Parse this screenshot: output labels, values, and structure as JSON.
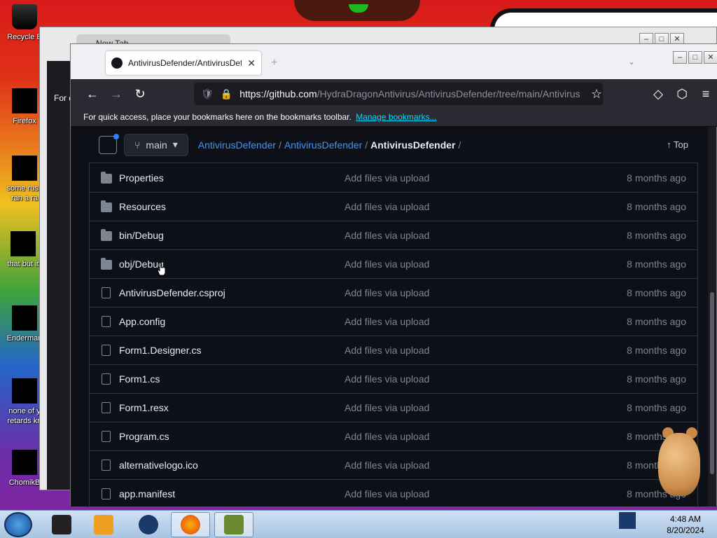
{
  "desktop": {
    "icons": [
      {
        "label": "Recycle B"
      },
      {
        "label": "Firefox"
      },
      {
        "label": "some russ ran a ra"
      },
      {
        "label": "that but it"
      },
      {
        "label": "Enderman"
      },
      {
        "label": "none of y retards kn"
      },
      {
        "label": "ChomikB"
      }
    ]
  },
  "back_window": {
    "tab_label": "New Tab",
    "bookmark_text": "For q"
  },
  "browser": {
    "tab_title": "AntivirusDefender/AntivirusDefender",
    "url_host": "https://github.com",
    "url_path": "/HydraDragonAntivirus/AntivirusDefender/tree/main/Antivirus",
    "bookmarks_text": "For quick access, place your bookmarks here on the bookmarks toolbar.",
    "bookmarks_link": "Manage bookmarks..."
  },
  "repo": {
    "branch": "main",
    "crumb_owner": "AntivirusDefender",
    "crumb_repo": "AntivirusDefender",
    "crumb_current": "AntivirusDefender",
    "top_label": "Top",
    "files": [
      {
        "name": "Properties",
        "type": "folder",
        "message": "Add files via upload",
        "age": "8 months ago"
      },
      {
        "name": "Resources",
        "type": "folder",
        "message": "Add files via upload",
        "age": "8 months ago"
      },
      {
        "name": "bin/Debug",
        "type": "folder",
        "message": "Add files via upload",
        "age": "8 months ago"
      },
      {
        "name": "obj/Debug",
        "type": "folder",
        "message": "Add files via upload",
        "age": "8 months ago"
      },
      {
        "name": "AntivirusDefender.csproj",
        "type": "file",
        "message": "Add files via upload",
        "age": "8 months ago"
      },
      {
        "name": "App.config",
        "type": "file",
        "message": "Add files via upload",
        "age": "8 months ago"
      },
      {
        "name": "Form1.Designer.cs",
        "type": "file",
        "message": "Add files via upload",
        "age": "8 months ago"
      },
      {
        "name": "Form1.cs",
        "type": "file",
        "message": "Add files via upload",
        "age": "8 months ago"
      },
      {
        "name": "Form1.resx",
        "type": "file",
        "message": "Add files via upload",
        "age": "8 months ago"
      },
      {
        "name": "Program.cs",
        "type": "file",
        "message": "Add files via upload",
        "age": "8 months ago"
      },
      {
        "name": "alternativelogo.ico",
        "type": "file",
        "message": "Add files via upload",
        "age": "8 months ago"
      },
      {
        "name": "app.manifest",
        "type": "file",
        "message": "Add files via upload",
        "age": "8 months ago"
      }
    ]
  },
  "taskbar": {
    "time": "4:48 AM",
    "date": "8/20/2024",
    "items": [
      "terminal",
      "media-player",
      "globe",
      "firefox",
      "chomikbox"
    ]
  },
  "colors": {
    "github_bg": "#0d1117",
    "link": "#4493f8",
    "muted": "#7d8590",
    "firefox_chrome": "#2b2a33"
  }
}
